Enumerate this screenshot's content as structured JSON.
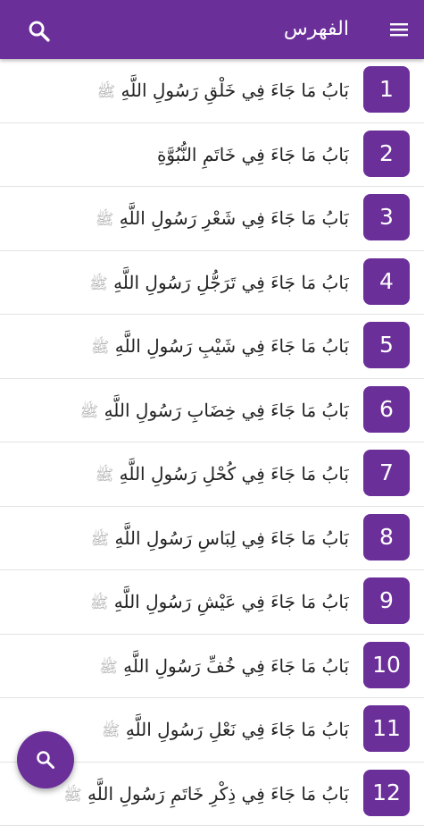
{
  "header": {
    "title": "الفهرس",
    "menu_icon": "menu-icon",
    "search_icon": "search-icon"
  },
  "items": [
    {
      "number": "1",
      "text": "بَابُ مَا جَاءَ فِي خَلْقِ رَسُولِ اللَّهِ",
      "honorific": "ﷺ"
    },
    {
      "number": "2",
      "text": "بَابُ مَا جَاءَ فِي خَاتَمِ النُّبُوَّةِ",
      "honorific": ""
    },
    {
      "number": "3",
      "text": "بَابُ مَا جَاءَ فِي شَعْرِ رَسُولِ اللَّهِ",
      "honorific": "ﷺ"
    },
    {
      "number": "4",
      "text": "بَابُ مَا جَاءَ فِي تَرَجُّلِ رَسُولِ اللَّهِ",
      "honorific": "ﷺ"
    },
    {
      "number": "5",
      "text": "بَابُ مَا جَاءَ فِي شَيْبِ رَسُولِ اللَّهِ",
      "honorific": "ﷺ"
    },
    {
      "number": "6",
      "text": "بَابُ مَا جَاءَ فِي خِضَابِ رَسُولِ اللَّهِ",
      "honorific": "ﷺ"
    },
    {
      "number": "7",
      "text": "بَابُ مَا جَاءَ فِي كُحْلِ رَسُولِ اللَّهِ",
      "honorific": "ﷺ"
    },
    {
      "number": "8",
      "text": "بَابُ مَا جَاءَ فِي لِبَاسِ رَسُولِ اللَّهِ",
      "honorific": "ﷺ"
    },
    {
      "number": "9",
      "text": "بَابُ مَا جَاءَ فِي عَيْشِ رَسُولِ اللَّهِ",
      "honorific": "ﷺ"
    },
    {
      "number": "10",
      "text": "بَابُ مَا جَاءَ فِي خُفِّ رَسُولِ اللَّهِ",
      "honorific": "ﷺ"
    },
    {
      "number": "11",
      "text": "بَابُ مَا جَاءَ فِي نَعْلِ رَسُولِ اللَّهِ",
      "honorific": "ﷺ"
    },
    {
      "number": "12",
      "text": "بَابُ مَا جَاءَ فِي ذِكْرِ خَاتَمِ رَسُولِ اللَّهِ",
      "honorific": "ﷺ"
    }
  ],
  "fab": {
    "icon": "search-icon"
  },
  "colors": {
    "primary": "#6a2f99",
    "honorific": "#a9a9a9",
    "divider": "#e2e2e2"
  }
}
